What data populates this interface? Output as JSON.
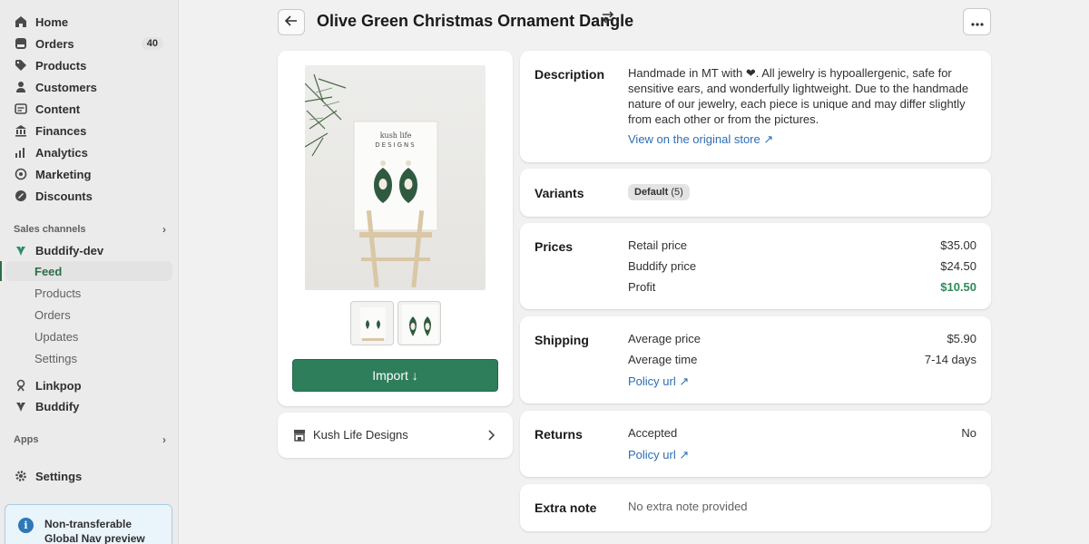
{
  "sidebar": {
    "items": [
      {
        "label": "Home",
        "icon": "home-icon"
      },
      {
        "label": "Orders",
        "icon": "orders-icon",
        "badge": "40"
      },
      {
        "label": "Products",
        "icon": "tag-icon"
      },
      {
        "label": "Customers",
        "icon": "person-icon"
      },
      {
        "label": "Content",
        "icon": "content-icon"
      },
      {
        "label": "Finances",
        "icon": "bank-icon"
      },
      {
        "label": "Analytics",
        "icon": "bar-chart-icon"
      },
      {
        "label": "Marketing",
        "icon": "target-icon"
      },
      {
        "label": "Discounts",
        "icon": "discount-icon"
      }
    ],
    "sales_channels_label": "Sales channels",
    "channel": {
      "label": "Buddify-dev",
      "icon": "buddify-icon"
    },
    "channel_sub": [
      "Feed",
      "Products",
      "Orders",
      "Updates",
      "Settings"
    ],
    "active_sub": "Feed",
    "extra": [
      {
        "label": "Linkpop",
        "icon": "linkpop-icon"
      },
      {
        "label": "Buddify",
        "icon": "buddify-icon"
      }
    ],
    "apps_label": "Apps",
    "settings_label": "Settings",
    "notice": "Non-transferable Global Nav preview"
  },
  "header": {
    "title": "Olive Green Christmas Ornament Dangle"
  },
  "product": {
    "card_brand": "kush life DESIGNS",
    "import_label": "Import ↓",
    "store_name": "Kush Life Designs"
  },
  "details": {
    "description": {
      "title": "Description",
      "text": "Handmade in MT with ❤. All jewelry is hypoallergenic, safe for sensitive ears, and wonderfully lightweight. Due to the handmade nature of our jewelry, each piece is unique and may differ slightly from each other or from the pictures.",
      "link": "View on the original store ↗"
    },
    "variants": {
      "title": "Variants",
      "tag_name": "Default",
      "tag_count": "(5)"
    },
    "prices": {
      "title": "Prices",
      "rows": [
        {
          "label": "Retail price",
          "value": "$35.00"
        },
        {
          "label": "Buddify price",
          "value": "$24.50"
        },
        {
          "label": "Profit",
          "value": "$10.50"
        }
      ],
      "profit_color": "#2e8b57"
    },
    "shipping": {
      "title": "Shipping",
      "rows": [
        {
          "label": "Average price",
          "value": "$5.90"
        },
        {
          "label": "Average time",
          "value": "7-14 days"
        }
      ],
      "link": "Policy url ↗"
    },
    "returns": {
      "title": "Returns",
      "accepted_label": "Accepted",
      "accepted_value": "No",
      "link": "Policy url ↗"
    },
    "extra_note": {
      "title": "Extra note",
      "text": "No extra note provided"
    }
  },
  "colors": {
    "primary": "#2e7d5b",
    "link": "#2d6db3"
  }
}
